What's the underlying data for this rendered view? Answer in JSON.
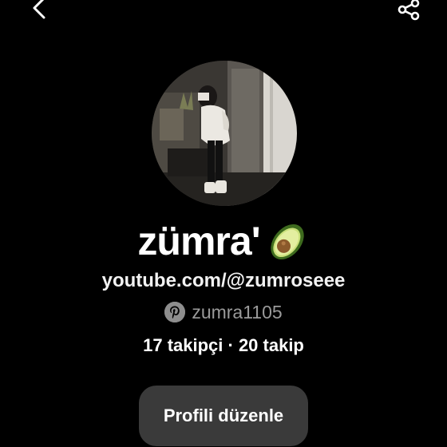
{
  "header": {
    "back_icon": "chevron-left-icon",
    "share_icon": "share-icon"
  },
  "profile": {
    "display_name": "zümra'",
    "emoji": "avocado",
    "website": "youtube.com/@zumroseee",
    "pinterest_handle": "zumra1105",
    "stats_text": "17 takipçi · 20 takip",
    "edit_button_label": "Profili düzenle"
  }
}
